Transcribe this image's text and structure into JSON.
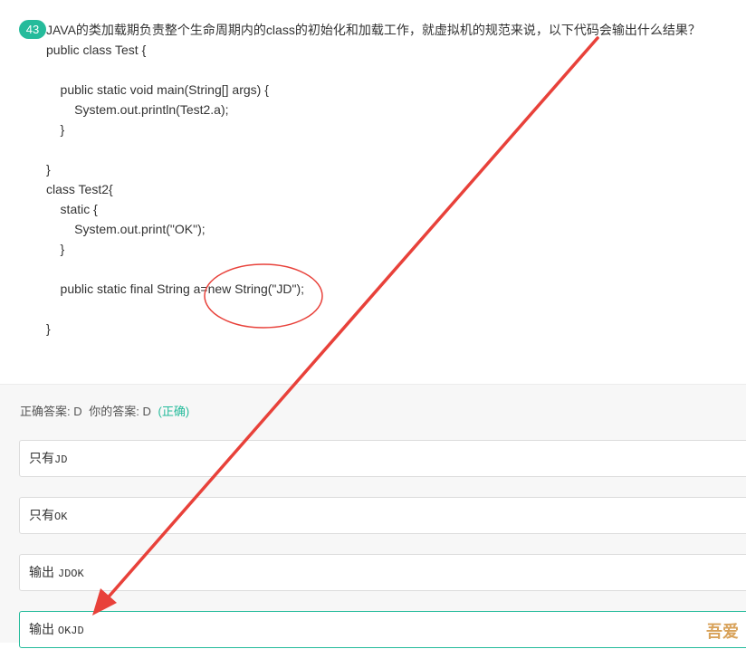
{
  "question": {
    "number": "43",
    "text": "JAVA的类加载期负责整个生命周期内的class的初始化和加载工作，就虚拟机的规范来说，以下代码会输出什么结果？",
    "code_lines": [
      "public class Test {",
      "",
      "    public static void main(String[] args) {",
      "        System.out.println(Test2.a);",
      "    }",
      "",
      "}",
      "class Test2{",
      "    static {",
      "        System.out.print(\"OK\");",
      "    }",
      "",
      "    public static final String a=new String(\"JD\");",
      "",
      "}"
    ]
  },
  "answer": {
    "correct_label": "正确答案: D",
    "your_label": "你的答案: D",
    "result": "(正确)"
  },
  "options": [
    {
      "prefix": "只有",
      "code": "JD"
    },
    {
      "prefix": "只有",
      "code": "OK"
    },
    {
      "prefix": "输出 ",
      "code": "JDOK"
    },
    {
      "prefix": "输出 ",
      "code": "OKJD"
    }
  ],
  "watermark": {
    "text": "吾爱"
  },
  "colors": {
    "accent": "#25bb9b",
    "annotation": "#e8413a"
  }
}
